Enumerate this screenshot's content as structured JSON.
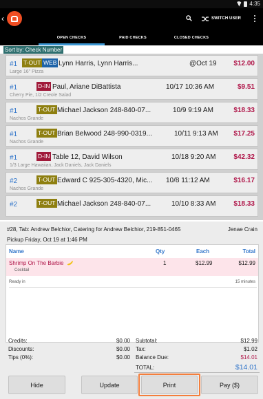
{
  "status_bar": {
    "time": "4:35"
  },
  "header": {
    "switch_user_label": "SWITCH USER"
  },
  "tabs": [
    {
      "label": "OPEN CHECKS",
      "active": true
    },
    {
      "label": "PAID CHECKS",
      "active": false
    },
    {
      "label": "CLOSED CHECKS",
      "active": false
    }
  ],
  "sort_label": "Sort by: Check Number",
  "checks": [
    {
      "num": "#1",
      "tag": "T-OUT",
      "tag2": "WEB",
      "name": "Lynn Harris, Lynn Harris...",
      "time": "@Oct 19",
      "amount": "$12.00",
      "sub": "Large 16\" Pizza"
    },
    {
      "num": "#1",
      "tag": "D-IN",
      "name": "Paul, Ariane DiBattista",
      "time": "10/17 10:36 AM",
      "amount": "$9.51",
      "sub": "Cherry Pie, 1/2 Creole Salad"
    },
    {
      "num": "#1",
      "tag": "T-OUT",
      "name": "Michael Jackson 248-840-07...",
      "time": "10/9 9:19 AM",
      "amount": "$18.33",
      "sub": "Nachos Grande"
    },
    {
      "num": "#1",
      "tag": "T-OUT",
      "name": "Brian Belwood 248-990-0319...",
      "time": "10/11 9:13 AM",
      "amount": "$17.25",
      "sub": "Nachos Grande"
    },
    {
      "num": "#1",
      "tag": "D-IN",
      "name": "Table 12, David Wilson",
      "time": "10/18 9:20 AM",
      "amount": "$42.32",
      "sub": "1/3 Large Hawaiian, Jack Daniels, Jack Daniels"
    },
    {
      "num": "#2",
      "tag": "T-OUT",
      "name": "Edward C 925-305-4320, Mic...",
      "time": "10/8 11:12 AM",
      "amount": "$16.17",
      "sub": "Nachos Grande"
    },
    {
      "num": "#2",
      "tag": "T-OUT",
      "name": "Michael Jackson 248-840-07...",
      "time": "10/10 8:33 AM",
      "amount": "$18.33",
      "sub": ""
    }
  ],
  "detail": {
    "info": "#28, Tab: Andrew Belchior, Catering for Andrew Belchior, 219-851-0465",
    "server": "Jenae Crain",
    "pickup": "Pickup Friday, Oct 19 at 1:46 PM",
    "headers": {
      "name": "Name",
      "qty": "Qty",
      "each": "Each",
      "total": "Total"
    },
    "items": [
      {
        "name": "Shrimp On The Barbie",
        "qty": "1",
        "each": "$12.99",
        "total": "$12.99",
        "modifier": "Cocktail"
      }
    ],
    "ready_label": "Ready in",
    "ready_value": "15 minutes",
    "totals": {
      "credits_label": "Credits:",
      "credits": "$0.00",
      "discounts_label": "Discounts:",
      "discounts": "$0.00",
      "tips_label": "Tips (0%):",
      "tips": "$0.00",
      "subtotal_label": "Subtotal:",
      "subtotal": "$12.99",
      "tax_label": "Tax:",
      "tax": "$1.02",
      "balance_label": "Balance Due:",
      "balance": "$14.01",
      "total_label": "TOTAL:",
      "total": "$14.01"
    }
  },
  "buttons": {
    "hide": "Hide",
    "update": "Update",
    "print": "Print",
    "pay": "Pay ($)"
  },
  "colors": {
    "accent": "#3c97d3",
    "logo": "#f04e23",
    "amount": "#b0174a",
    "tout": "#8e7f10",
    "din": "#a01a3a",
    "web": "#1e63a8",
    "print_highlight": "#f47e3c"
  }
}
